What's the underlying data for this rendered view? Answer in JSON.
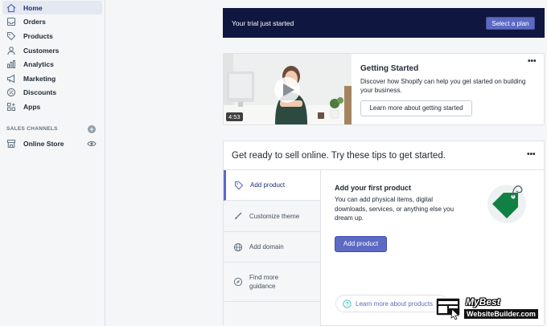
{
  "sidebar": {
    "items": [
      {
        "label": "Home",
        "icon": "home-icon"
      },
      {
        "label": "Orders",
        "icon": "orders-icon"
      },
      {
        "label": "Products",
        "icon": "tag-icon"
      },
      {
        "label": "Customers",
        "icon": "person-icon"
      },
      {
        "label": "Analytics",
        "icon": "bar-chart-icon"
      },
      {
        "label": "Marketing",
        "icon": "megaphone-icon"
      },
      {
        "label": "Discounts",
        "icon": "discount-icon"
      },
      {
        "label": "Apps",
        "icon": "apps-icon"
      }
    ],
    "section_title": "SALES CHANNELS",
    "section_add": "+",
    "channel": {
      "label": "Online Store"
    }
  },
  "trial": {
    "text": "Your trial just started",
    "button": "Select a plan"
  },
  "getting_started": {
    "title": "Getting Started",
    "description": "Discover how Shopify can help you get started on building your business.",
    "button": "Learn more about getting started",
    "video_duration": "4:53",
    "menu": "•••"
  },
  "tips": {
    "title": "Get ready to sell online. Try these tips to get started.",
    "menu": "•••",
    "tabs": [
      {
        "label": "Add product",
        "icon": "tag-icon"
      },
      {
        "label": "Customize theme",
        "icon": "brush-icon"
      },
      {
        "label": "Add domain",
        "icon": "globe-icon"
      },
      {
        "label": "Find more guidance",
        "icon": "compass-icon"
      }
    ],
    "content": {
      "title": "Add your first product",
      "description": "You can add physical items, digital downloads, services, or anything else you dream up.",
      "button": "Add product",
      "learn_more": "Learn more about products"
    }
  },
  "watermark": {
    "line1": "MyBest",
    "line2": "WebsiteBuilder.com"
  },
  "colors": {
    "accent": "#5c6ac4",
    "banner": "#0f1740",
    "tag_green": "#108043"
  }
}
